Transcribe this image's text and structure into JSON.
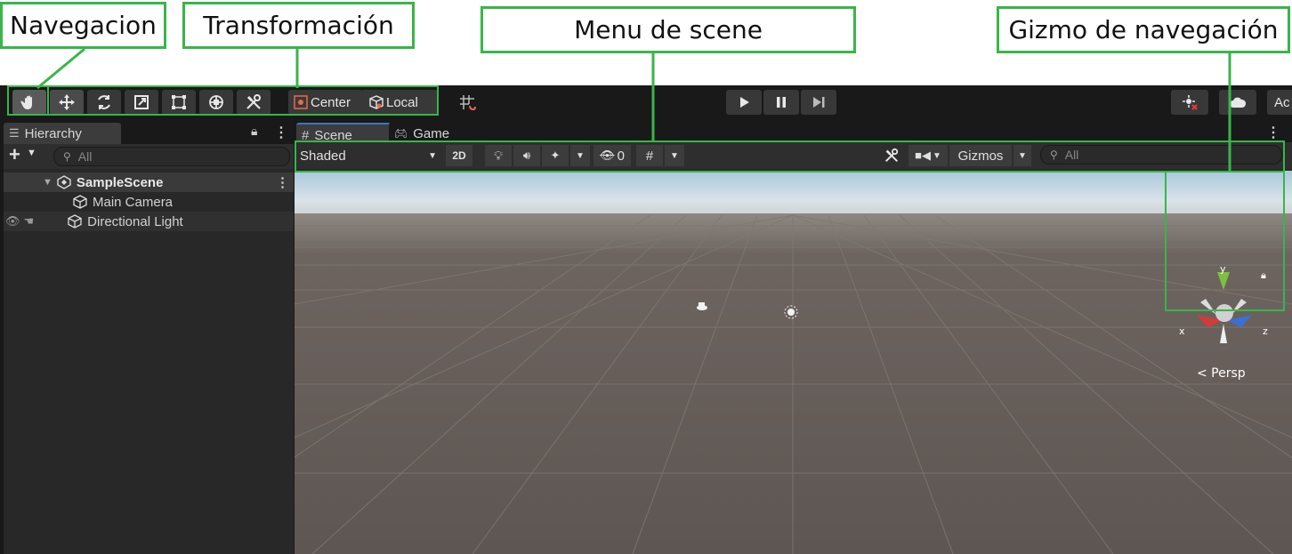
{
  "annotations": {
    "navegacion": "Navegacion",
    "transformacion": "Transformación",
    "menu_scene": "Menu de scene",
    "gizmo": "Gizmo de navegación"
  },
  "toolbar": {
    "tools": [
      "hand-tool",
      "move-tool",
      "rotate-tool",
      "scale-tool",
      "rect-tool",
      "transform-tool",
      "custom-tool"
    ],
    "pivot_label": "Center",
    "space_label": "Local",
    "play_controls": [
      "play",
      "pause",
      "step"
    ],
    "account_label": "Ac"
  },
  "hierarchy": {
    "tab_label": "Hierarchy",
    "search_placeholder": "All",
    "scene_name": "SampleScene",
    "items": [
      {
        "label": "Main Camera"
      },
      {
        "label": "Directional Light"
      }
    ]
  },
  "scene_view": {
    "tabs": [
      {
        "label": "Scene"
      },
      {
        "label": "Game"
      }
    ],
    "shading_mode": "Shaded",
    "mode_2d": "2D",
    "hidden_count": "0",
    "gizmos_label": "Gizmos",
    "search_placeholder": "All",
    "gizmo": {
      "y_label": "y",
      "x_label": "x",
      "z_label": "z",
      "projection_label": "< Persp",
      "colors": {
        "x": "#d23b3b",
        "y": "#7cc040",
        "z": "#3b6fd2"
      }
    }
  },
  "colors": {
    "highlight": "#39b54a",
    "editor_bg": "#191919",
    "panel_bg": "#282828"
  }
}
